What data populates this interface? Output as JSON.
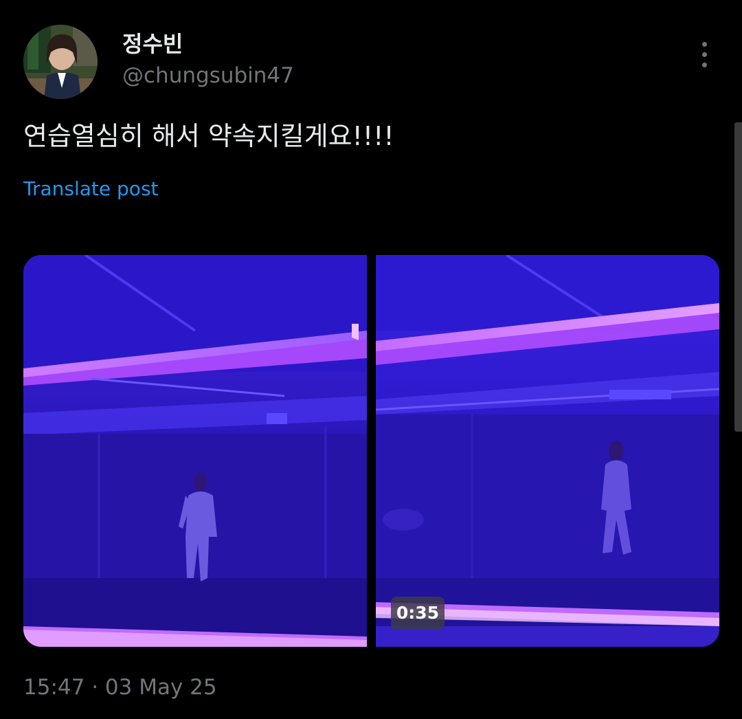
{
  "author": {
    "display_name": "정수빈",
    "handle": "@chungsubin47",
    "avatar_icon": "profile-photo"
  },
  "post": {
    "text": "연습열심히 해서 약속지킬게요!!!!",
    "translate_label": "Translate post",
    "timestamp": "15:47 · 03 May 25"
  },
  "media": {
    "items": [
      {
        "kind": "photo",
        "icon": "dance-studio-photo"
      },
      {
        "kind": "video",
        "icon": "dance-studio-video",
        "duration": "0:35"
      }
    ]
  },
  "colors": {
    "background": "#000000",
    "primary_text": "#e7e9ea",
    "secondary_text": "#71767b",
    "link": "#1d9bf0",
    "neon_purple": "#b040ff",
    "studio_blue": "#3a1fd0"
  },
  "icons": {
    "more": "more-vertical-icon"
  }
}
